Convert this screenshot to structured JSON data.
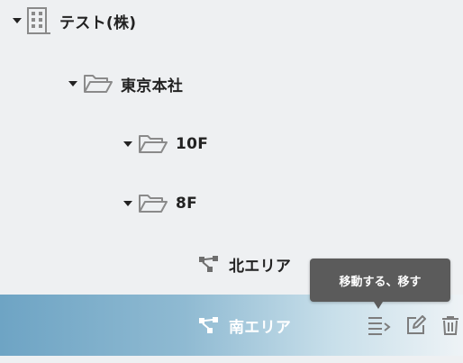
{
  "tree": {
    "company": {
      "label": "テスト(株)",
      "icon": "building-icon"
    },
    "headquarters": {
      "label": "東京本社",
      "icon": "folder-open-icon"
    },
    "floor_10": {
      "label": "10F",
      "icon": "folder-open-icon"
    },
    "floor_8": {
      "label": "8F",
      "icon": "folder-open-icon"
    },
    "area_north": {
      "label": "北エリア",
      "icon": "hierarchy-icon"
    },
    "area_south": {
      "label": "南エリア",
      "icon": "hierarchy-icon",
      "selected": true
    }
  },
  "row_actions": {
    "move": {
      "icon": "move-list-icon"
    },
    "edit": {
      "icon": "edit-icon"
    },
    "delete": {
      "icon": "trash-icon"
    }
  },
  "tooltip": {
    "text": "移動する、移す"
  },
  "colors": {
    "background": "#eef0f2",
    "selected_start": "#6ea4c4",
    "selected_end": "#eef3f6",
    "tooltip_bg": "#5b5b5b",
    "icon_gray": "#8a8a8a"
  }
}
